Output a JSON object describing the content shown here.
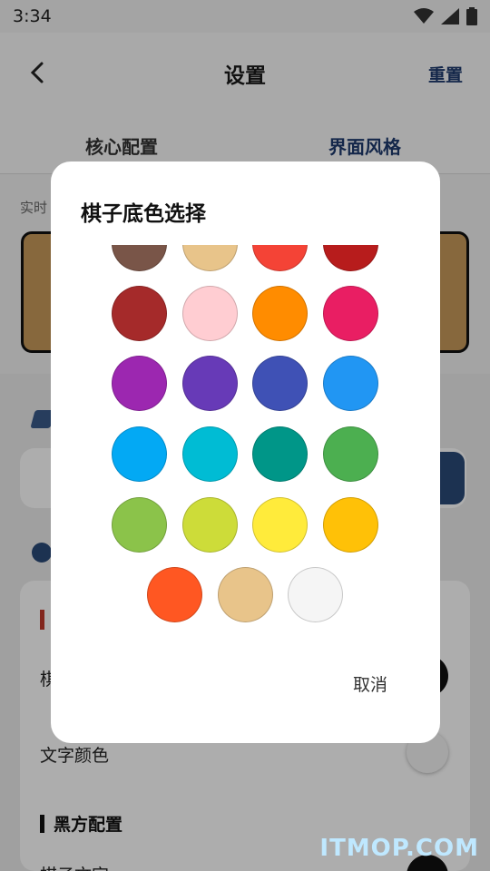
{
  "status_bar": {
    "time": "3:34"
  },
  "app_bar": {
    "title": "设置",
    "reset_label": "重置"
  },
  "tabs": [
    {
      "label": "核心配置"
    },
    {
      "label": "界面风格"
    }
  ],
  "preview": {
    "label": "实时"
  },
  "settings": {
    "row1_label": "棋",
    "row2_label": "文字颜色",
    "black_section": "黑方配置",
    "row3_label": "棋子文字"
  },
  "dialog": {
    "title": "棋子底色选择",
    "cancel_label": "取消",
    "swatches": [
      "#795548",
      "#e8c48a",
      "#f44336",
      "#b71c1c",
      "#a52a2a",
      "#ffcdd2",
      "#ff8c00",
      "#e91e63",
      "#9c27b0",
      "#673ab7",
      "#3f51b5",
      "#2196f3",
      "#03a9f4",
      "#00bcd4",
      "#009688",
      "#4caf50",
      "#8bc34a",
      "#cddc39",
      "#ffeb3b",
      "#ffc107",
      "#ff5722",
      "#e8c48a",
      "#f5f5f5"
    ]
  },
  "watermark": "ITMOP.COM"
}
